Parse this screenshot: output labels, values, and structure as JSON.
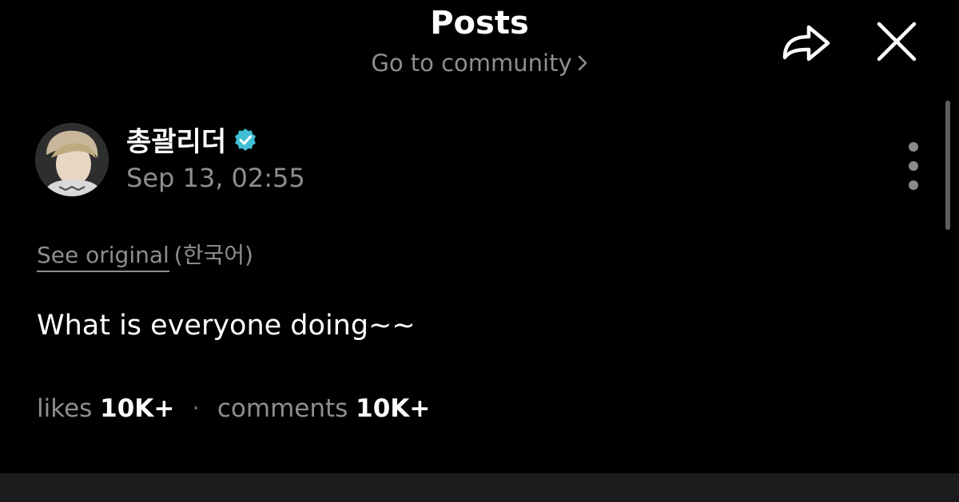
{
  "header": {
    "title": "Posts",
    "community_link": "Go to community",
    "share_icon": "share-arrow-icon",
    "close_icon": "close-icon"
  },
  "post": {
    "author": {
      "name": "총괄리더",
      "verified": true,
      "verified_color": "#3fbfd3",
      "avatar_icon": "avatar-photo"
    },
    "timestamp": "Sep 13, 02:55",
    "translation": {
      "see_original_label": "See original",
      "language_label": "(한국어)"
    },
    "body": "What is everyone doing~~",
    "stats": {
      "likes_label": "likes",
      "likes_count": "10K+",
      "separator": "·",
      "comments_label": "comments",
      "comments_count": "10K+"
    }
  },
  "colors": {
    "background": "#000000",
    "secondary_text": "#8e8e8e",
    "primary_text": "#ffffff",
    "bottom_bar": "#1c1c1e"
  }
}
